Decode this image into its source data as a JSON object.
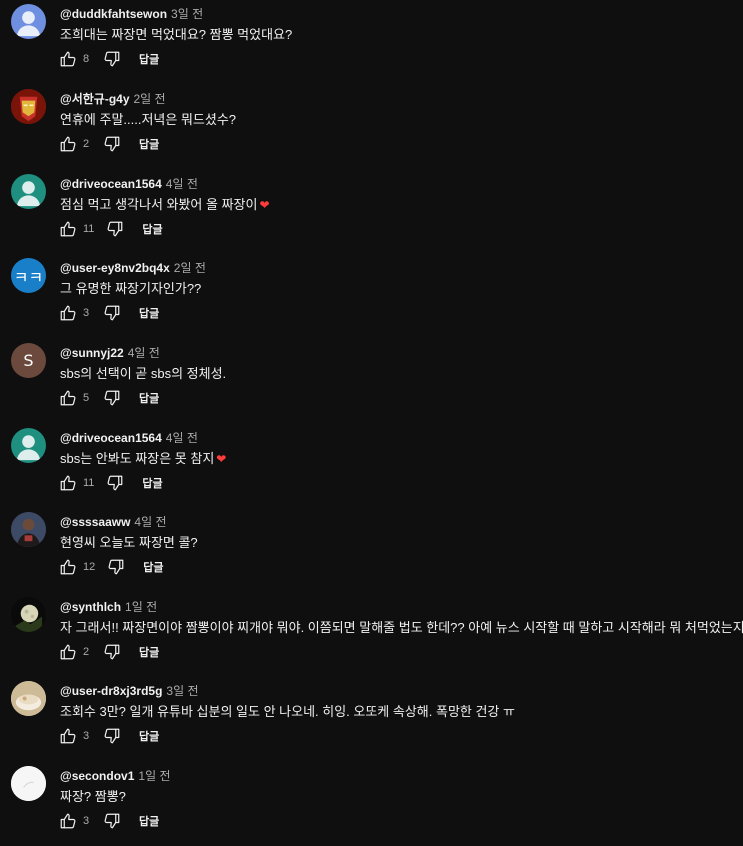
{
  "comments": [
    {
      "author": "@duddkfahtsewon",
      "time": "3일 전",
      "text": "조희대는 짜장면 먹었대요? 짬뽕 먹었대요?",
      "likes": "8",
      "reply": "답글",
      "avatar": {
        "kind": "person",
        "bg": "#6f8fe0"
      }
    },
    {
      "author": "@서한규-g4y",
      "time": "2일 전",
      "text": "연휴에 주말.....저녁은 뭐드셨수?",
      "likes": "2",
      "reply": "답글",
      "avatar": {
        "kind": "ironman",
        "bg": "#8b1a10"
      }
    },
    {
      "author": "@driveocean1564",
      "time": "4일 전",
      "text": "점심 먹고 생각나서 와봤어 올 짜장이",
      "heart": "❤",
      "likes": "11",
      "reply": "답글",
      "avatar": {
        "kind": "person",
        "bg": "#1f8f7f"
      }
    },
    {
      "author": "@user-ey8nv2bq4x",
      "time": "2일 전",
      "text": "그 유명한 짜장기자인가??",
      "likes": "3",
      "reply": "답글",
      "avatar": {
        "kind": "letter",
        "letter": "ㅋㅋ",
        "bg": "#1a7fc9"
      }
    },
    {
      "author": "@sunnyj22",
      "time": "4일 전",
      "text": "sbs의 선택이 곧 sbs의 정체성.",
      "likes": "5",
      "reply": "답글",
      "avatar": {
        "kind": "letter",
        "letter": "S",
        "bg": "#6b4a3d"
      }
    },
    {
      "author": "@driveocean1564",
      "time": "4일 전",
      "text": "sbs는 안봐도 짜장은 못 참지",
      "heart": "❤",
      "likes": "11",
      "reply": "답글",
      "avatar": {
        "kind": "person",
        "bg": "#1f8f7f"
      }
    },
    {
      "author": "@ssssaaww",
      "time": "4일 전",
      "text": "현영씨 오늘도 짜장면 콜?",
      "likes": "12",
      "reply": "답글",
      "avatar": {
        "kind": "photo",
        "bg": "#3a2e2a"
      }
    },
    {
      "author": "@synthlch",
      "time": "1일 전",
      "text": "자 그래서!! 짜장면이야 짬뽕이야 찌개야 뭐야. 이쯤되면 말해줄 법도 한데?? 아예 뉴스 시작할 때 말하고 시작해라 뭐 처먹었는지~~",
      "likes": "2",
      "reply": "답글",
      "avatar": {
        "kind": "moon",
        "bg": "#111111"
      }
    },
    {
      "author": "@user-dr8xj3rd5g",
      "time": "3일 전",
      "text": "조회수 3만? 일개 유튜바 십분의 일도 안 나오네. 히잉. 오또케 속상해. 폭망한 건강 ㅠ",
      "likes": "3",
      "reply": "답글",
      "avatar": {
        "kind": "food",
        "bg": "#d9cbb0"
      }
    },
    {
      "author": "@secondov1",
      "time": "1일 전",
      "text": "짜장? 짬뽕?",
      "likes": "3",
      "reply": "답글",
      "avatar": {
        "kind": "white",
        "bg": "#f4f4f4"
      }
    }
  ],
  "icons": {
    "like": "thumb-up-icon",
    "dislike": "thumb-down-icon"
  },
  "colors": {
    "background": "#0f0f0f",
    "text": "#f1f1f1",
    "secondary": "#aaaaaa",
    "heart": "#ff3b3b"
  }
}
